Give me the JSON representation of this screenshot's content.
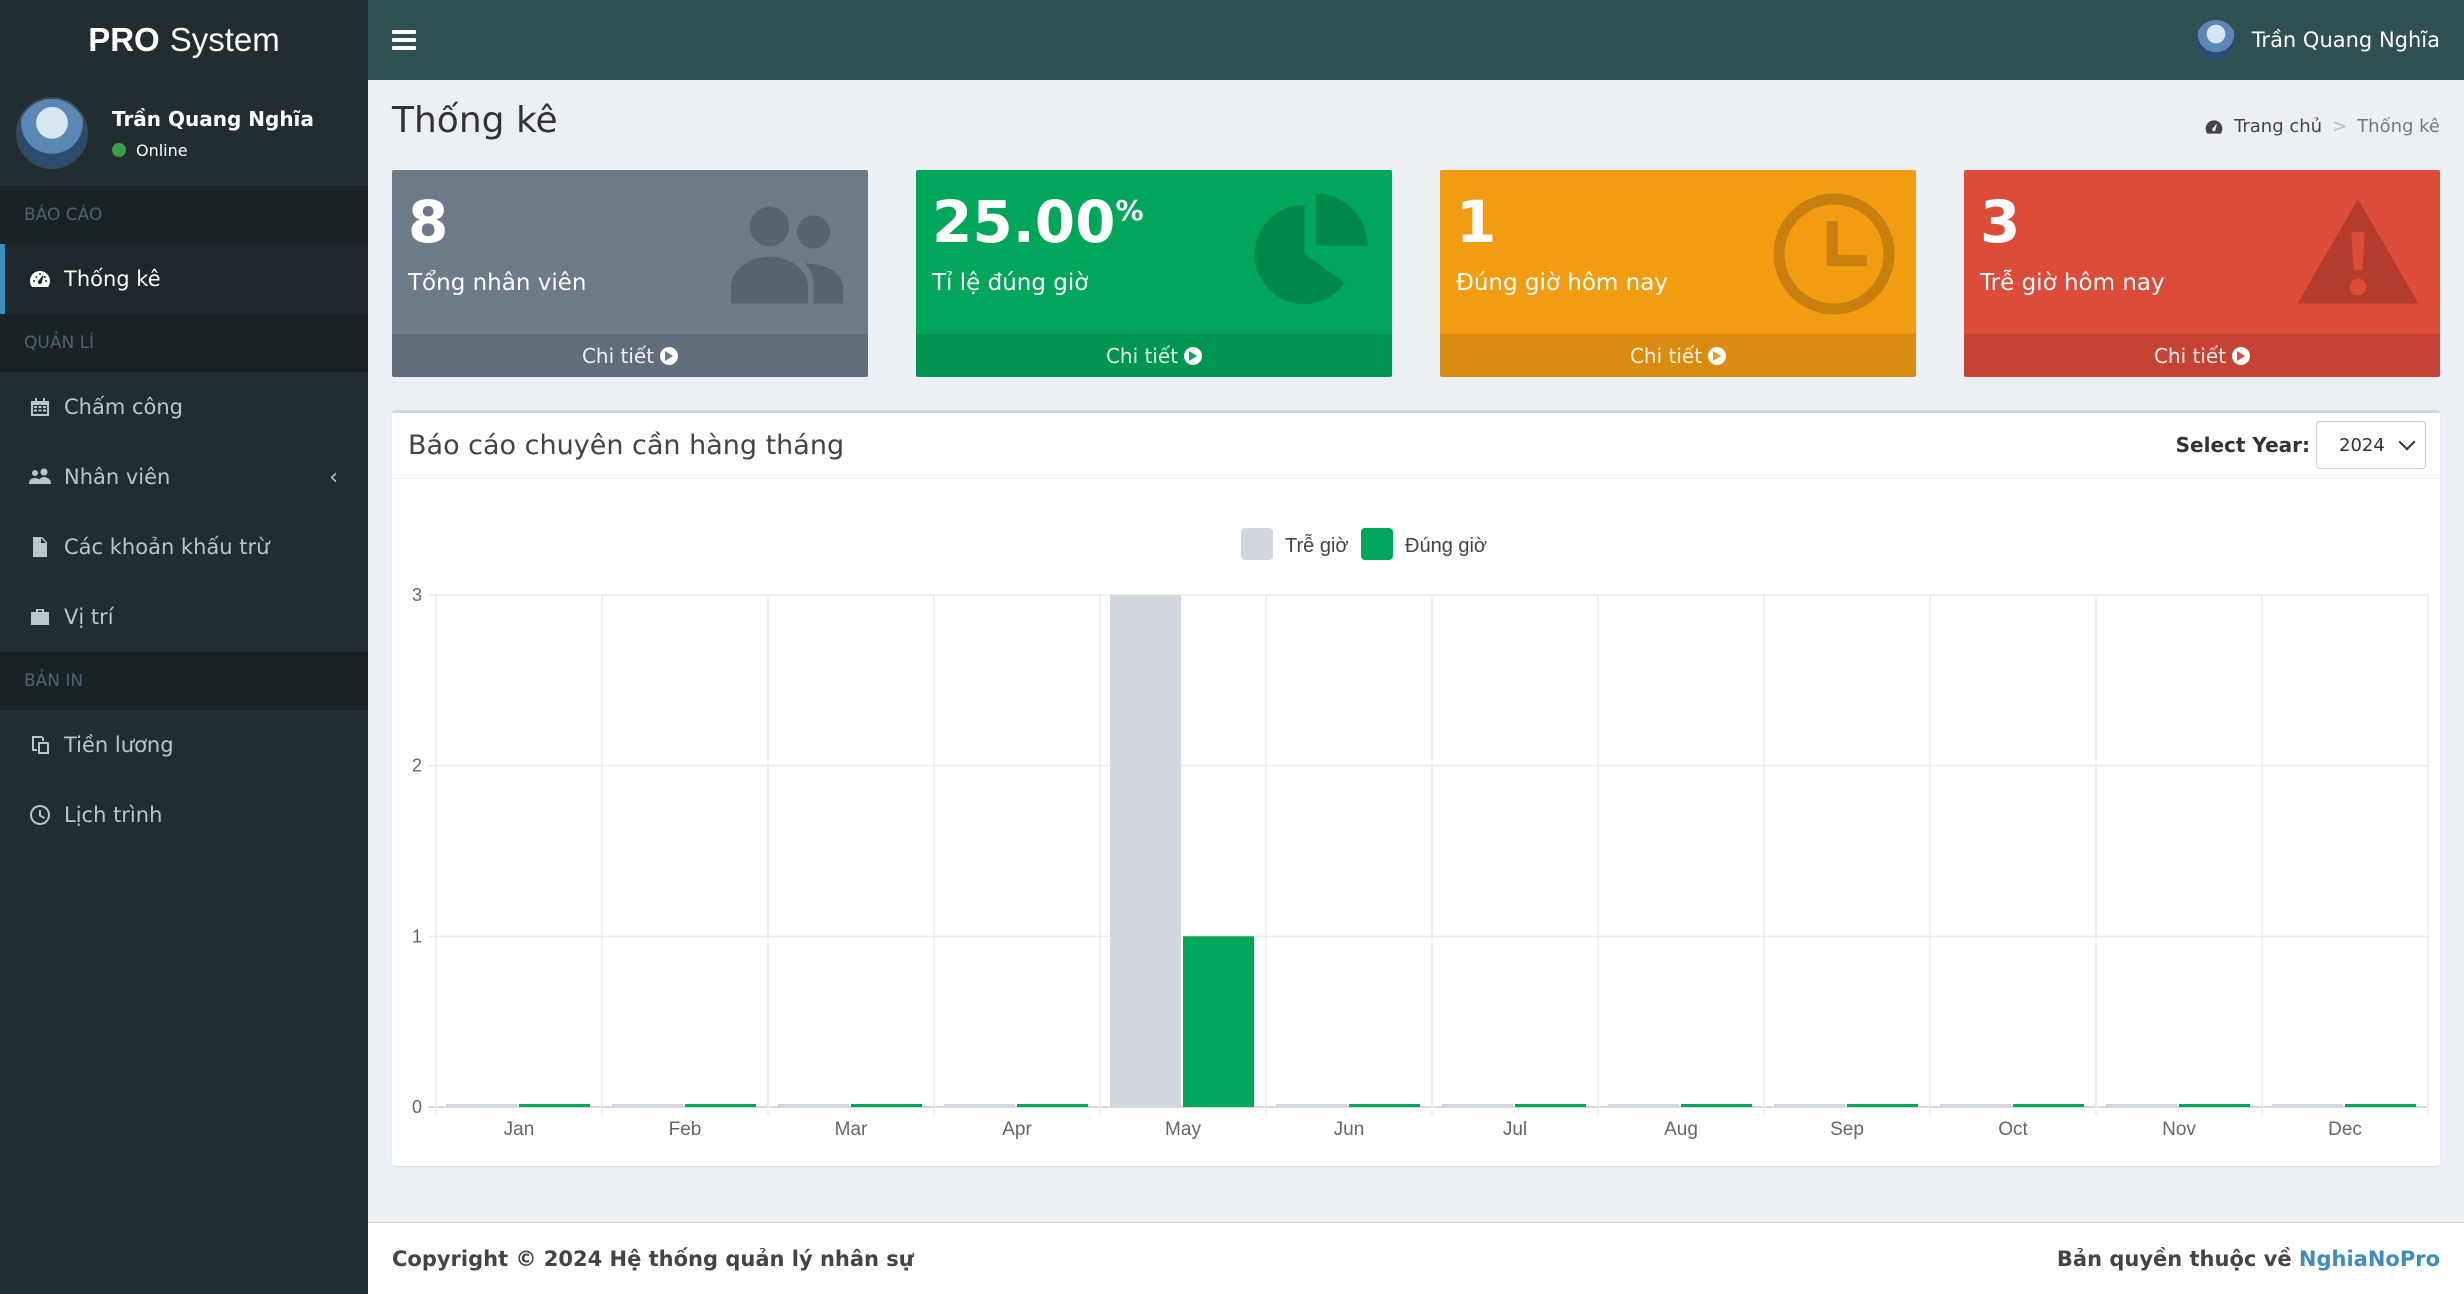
{
  "app": {
    "brand_bold": "PRO",
    "brand_rest": "System"
  },
  "user": {
    "name": "Trần Quang Nghĩa",
    "status": "Online"
  },
  "sidebar": {
    "sections": [
      {
        "header": "BÁO CÁO"
      },
      {
        "header": "QUẢN LÍ"
      },
      {
        "header": "BẢN IN"
      }
    ],
    "items": [
      {
        "label": "Thống kê",
        "icon": "dashboard-icon"
      },
      {
        "label": "Chấm công",
        "icon": "calendar-icon"
      },
      {
        "label": "Nhân viên",
        "icon": "users-icon"
      },
      {
        "label": "Các khoản khấu trừ",
        "icon": "file-icon"
      },
      {
        "label": "Vị trí",
        "icon": "briefcase-icon"
      },
      {
        "label": "Tiền lương",
        "icon": "copy-icon"
      },
      {
        "label": "Lịch trình",
        "icon": "clock-icon"
      }
    ]
  },
  "page": {
    "title": "Thống kê"
  },
  "breadcrumb": {
    "home": "Trang chủ",
    "sep": ">",
    "current": "Thống kê"
  },
  "stats": [
    {
      "value": "8",
      "suffix": "",
      "label": "Tổng nhân viên",
      "footer": "Chi tiết",
      "color": "#6c7a89",
      "icon": "users-icon"
    },
    {
      "value": "25.00",
      "suffix": "%",
      "label": "Tỉ lệ đúng giờ",
      "footer": "Chi tiết",
      "color": "#00a65a",
      "icon": "pie-chart-icon"
    },
    {
      "value": "1",
      "suffix": "",
      "label": "Đúng giờ hôm nay",
      "footer": "Chi tiết",
      "color": "#f39c12",
      "icon": "clock-icon"
    },
    {
      "value": "3",
      "suffix": "",
      "label": "Trễ giờ hôm nay",
      "footer": "Chi tiết",
      "color": "#dd4b39",
      "icon": "warning-icon"
    }
  ],
  "chart_box": {
    "title": "Báo cáo chuyên cần hàng tháng",
    "select_label": "Select Year:",
    "select_value": "2024"
  },
  "chart_data": {
    "type": "bar",
    "categories": [
      "Jan",
      "Feb",
      "Mar",
      "Apr",
      "May",
      "Jun",
      "Jul",
      "Aug",
      "Sep",
      "Oct",
      "Nov",
      "Dec"
    ],
    "series": [
      {
        "name": "Trễ giờ",
        "color": "#d2d6de",
        "values": [
          0,
          0,
          0,
          0,
          3,
          0,
          0,
          0,
          0,
          0,
          0,
          0
        ]
      },
      {
        "name": "Đúng giờ",
        "color": "#00a65a",
        "values": [
          0,
          0,
          0,
          0,
          1,
          0,
          0,
          0,
          0,
          0,
          0,
          0
        ]
      }
    ],
    "ylim": [
      0,
      3
    ],
    "yticks": [
      0,
      1,
      2,
      3
    ],
    "legend": "top-center",
    "grid": true
  },
  "footer": {
    "copyright": "Copyright © 2024 Hệ thống quản lý nhân sự",
    "owner_prefix": "Bản quyền thuộc về",
    "owner_link": "NghiaNoPro"
  }
}
